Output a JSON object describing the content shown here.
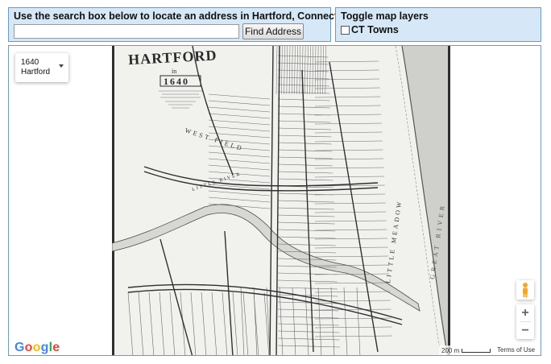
{
  "search_panel": {
    "title": "Use the search box below to locate an address in Hartford, Connecticut.",
    "input_value": "",
    "input_placeholder": "",
    "button_label": "Find Address"
  },
  "layers_panel": {
    "title": "Toggle map layers",
    "layers": [
      {
        "label": "CT Towns",
        "checked": false
      }
    ]
  },
  "map": {
    "layer_select": {
      "line1": "1640",
      "line2": "Hartford"
    },
    "historic_map": {
      "title_fragment": "HARTFORD",
      "in_text": "in",
      "year": "1640",
      "field_label": "WEST FIELD",
      "river_label": "LITTLE RIVER",
      "meadow_label": "LITTLE MEADOW",
      "great_river_label": "GREAT RIVER"
    },
    "google_logo": [
      "G",
      "o",
      "o",
      "g",
      "l",
      "e"
    ],
    "google_colors": [
      "#4285F4",
      "#EA4335",
      "#FBBC05",
      "#4285F4",
      "#34A853",
      "#EA4335"
    ],
    "zoom_in": "+",
    "zoom_out": "−",
    "scale_label": "200 m",
    "terms_label": "Terms of Use",
    "pegman_icon": "pegman-icon",
    "colors": {
      "panel_background": "#d6e8f7",
      "panel_border": "#6b9ac4",
      "paper": "#f1f1ee",
      "ink": "#3a3a3a",
      "river_water": "#cfcfcb",
      "pegman": "#f5a623"
    }
  }
}
